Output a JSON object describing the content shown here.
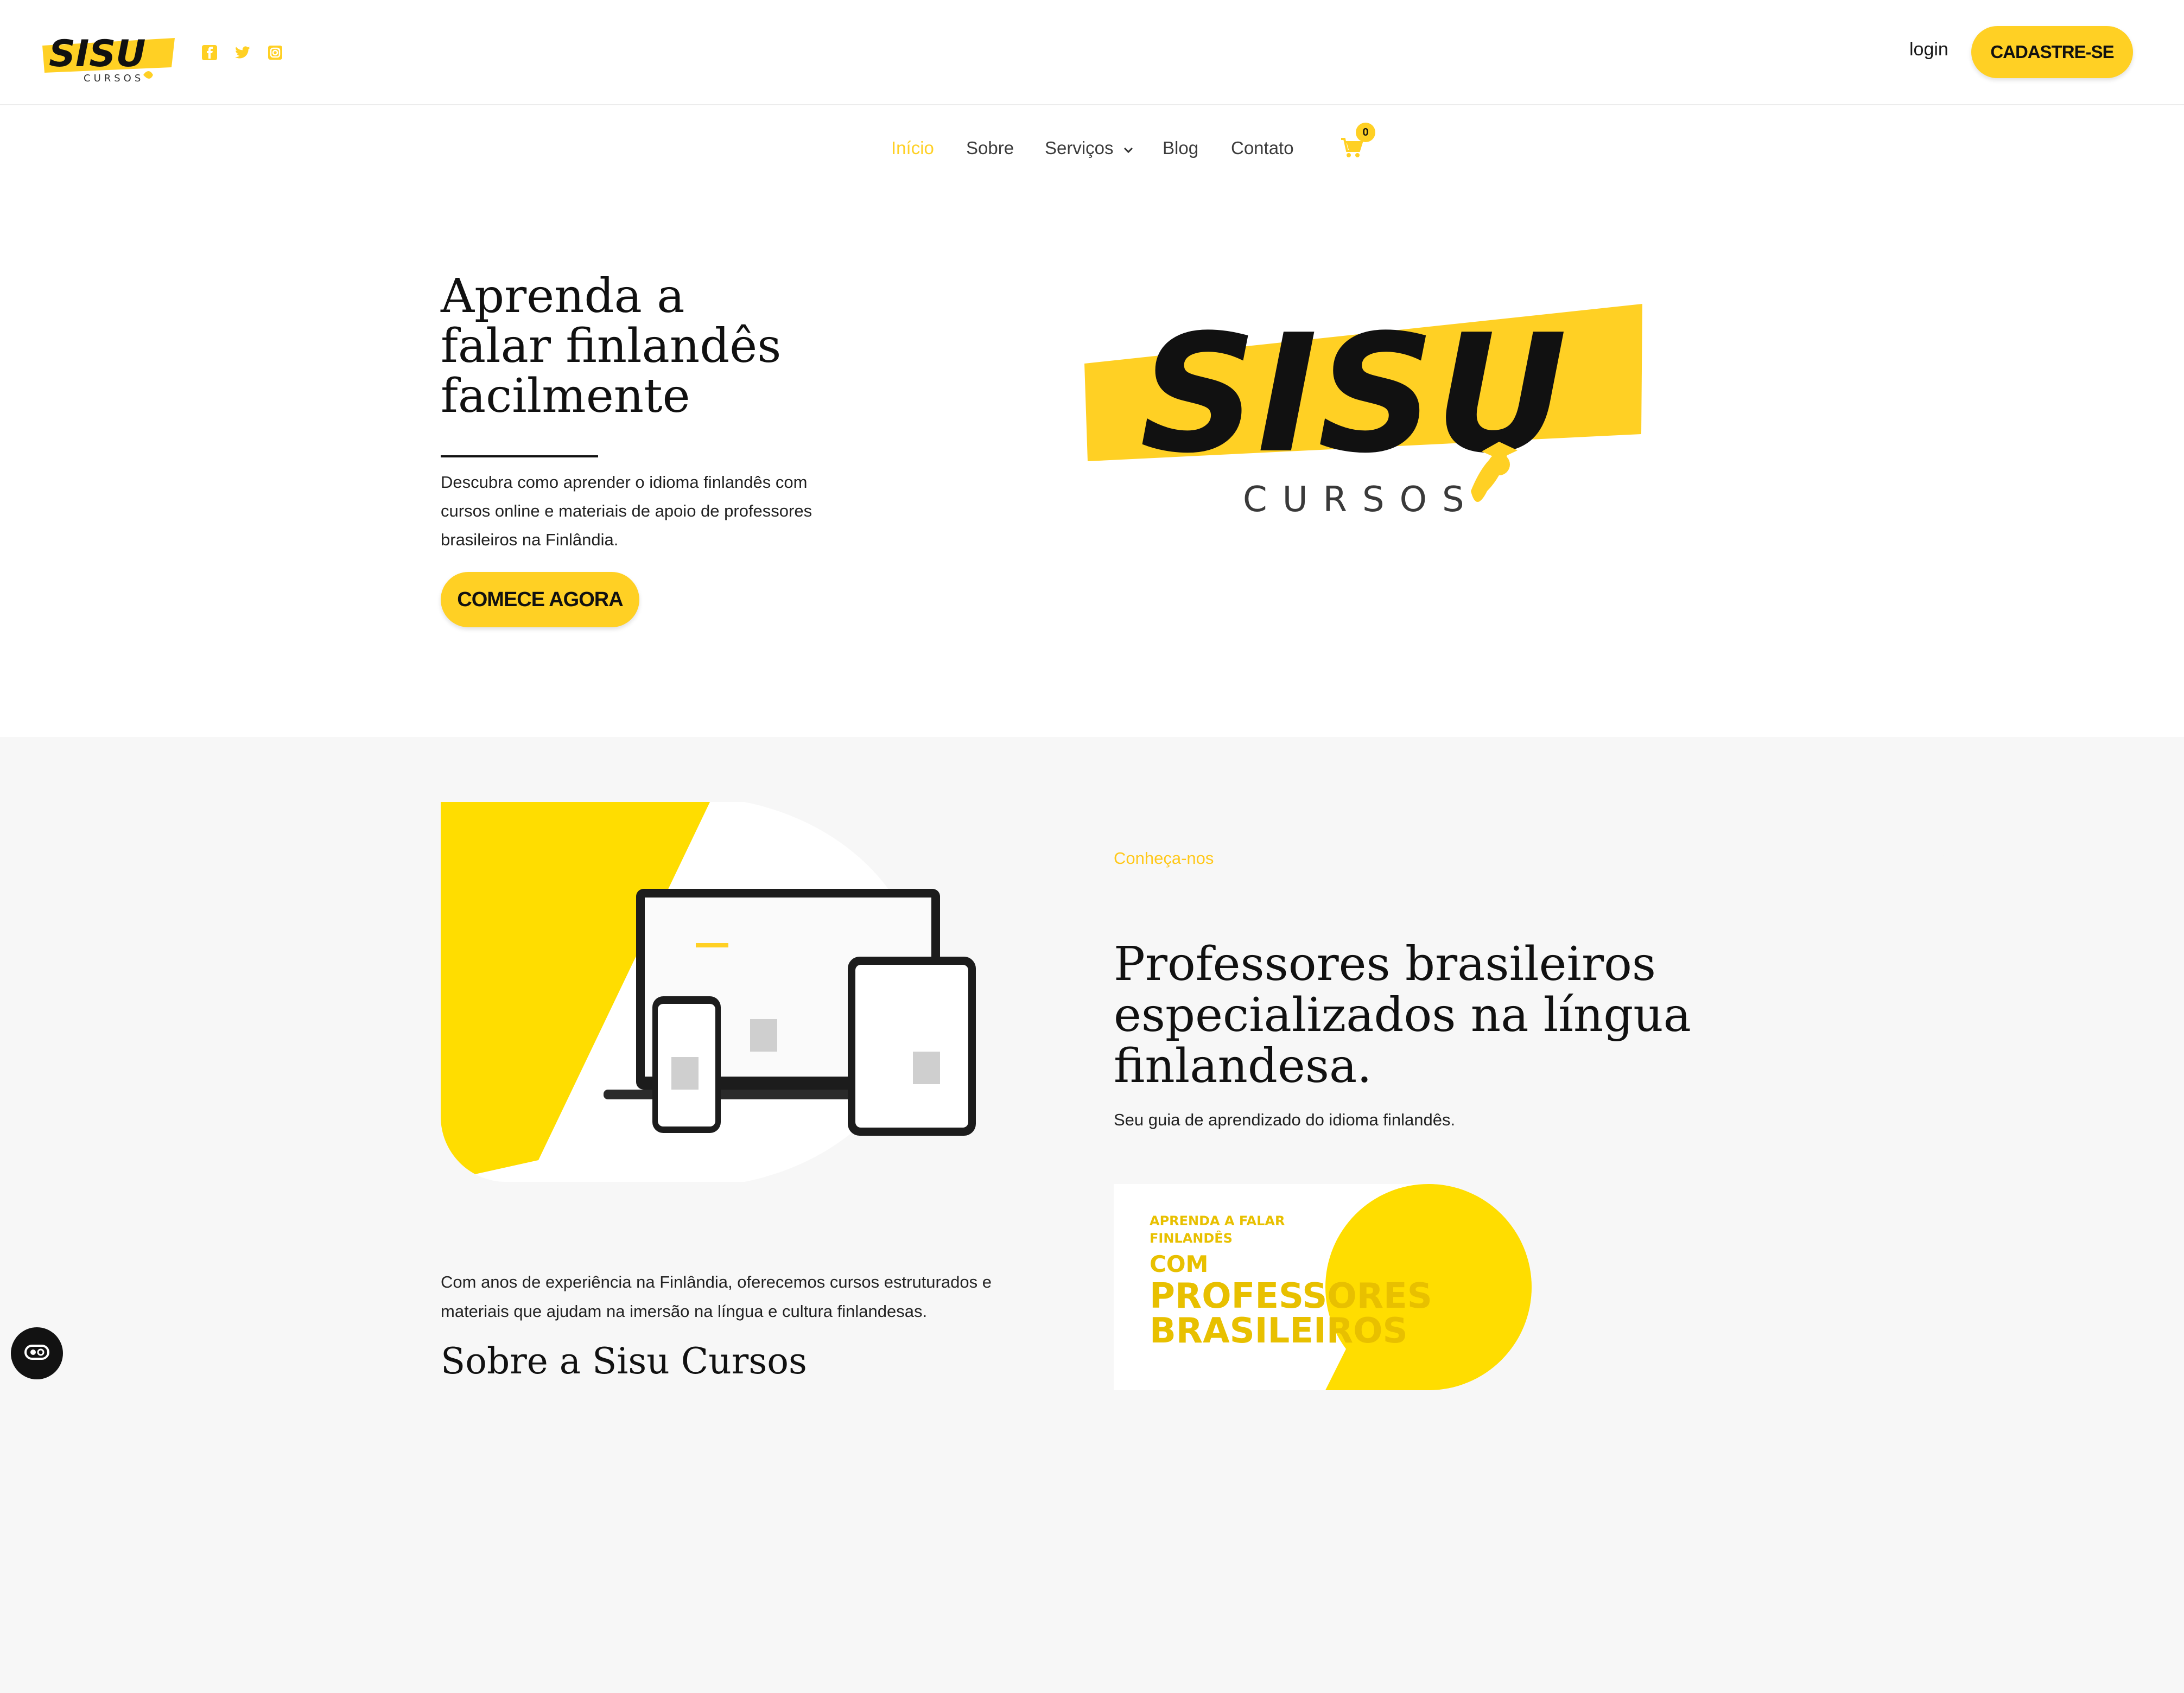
{
  "header": {
    "logo_alt": "Sisu Cursos",
    "social": [
      {
        "icon": "facebook-icon"
      },
      {
        "icon": "twitter-icon"
      },
      {
        "icon": "instagram-icon"
      }
    ],
    "login_label": "login",
    "signup_label": "CADASTRE-SE"
  },
  "nav": {
    "items": [
      "Início",
      "Sobre",
      "Serviços",
      "Blog",
      "Contato"
    ],
    "cart_count": "0"
  },
  "hero": {
    "title_line1": "Aprenda a",
    "title_line2": "falar finlandês",
    "title_line3": "facilmente",
    "description": "Descubra como aprender o idioma finlandês com cursos online e materiais de apoio de professores brasileiros na Finlândia.",
    "cta_label": "COMECE AGORA",
    "logo_word": "SISU",
    "logo_subword": "CURSOS"
  },
  "about": {
    "eyebrow": "Conheça-nos",
    "title": "Professores brasileiros especializados na língua finlandesa.",
    "subtitle": "Seu guia de aprendizado do idioma finlandês.",
    "body": "Com anos de experiência na Finlândia, oferecemos cursos estruturados e materiais que ajudam na imersão na língua e cultura finlandesas.",
    "heading": "Sobre a Sisu Cursos",
    "promo_line1": "APRENDA A FALAR",
    "promo_line2": "FINLANDÊS",
    "promo_line3": "COM",
    "promo_line4": "PROFESSORES",
    "promo_line5": "BRASILEIROS"
  },
  "colors": {
    "brand_yellow": "#ffd024",
    "dark": "#111111",
    "light_bg": "#f7f7f7"
  }
}
